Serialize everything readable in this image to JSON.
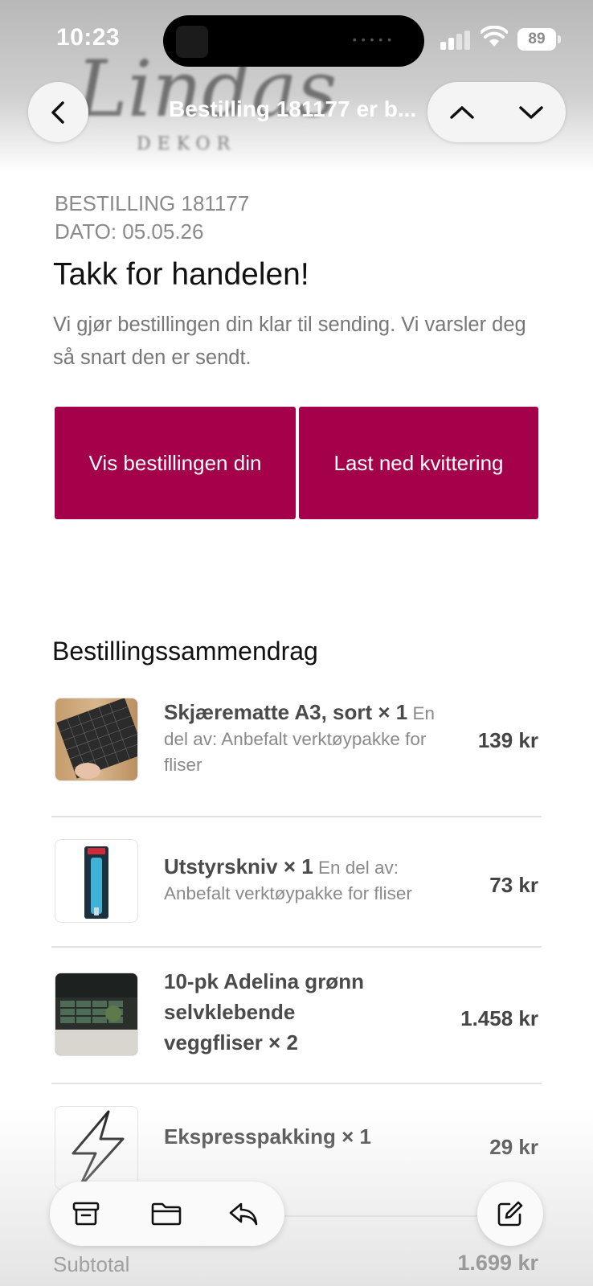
{
  "status_bar": {
    "time": "10:23",
    "battery": "89"
  },
  "header": {
    "logo_script": "Lindas",
    "logo_sub": "DEKOR",
    "title": "Bestilling 181177 er b...",
    "back_icon": "chevron-left-icon",
    "prev_icon": "chevron-up-icon",
    "next_icon": "chevron-down-icon"
  },
  "email": {
    "order_number": "BESTILLING 181177",
    "order_date": "DATO: 05.05.26",
    "headline": "Takk for handelen!",
    "intro": "Vi gjør bestillingen din klar til sending. Vi varsler deg så snart den er sendt.",
    "buttons": {
      "view_order": "Vis bestillingen din",
      "download_receipt": "Last ned kvittering"
    },
    "accent_color": "#a5014a",
    "summary_title": "Bestillingssammendrag",
    "items": [
      {
        "name": "Skjærematte A3, sort × 1",
        "note": "En del av: Anbefalt verktøypakke for fliser",
        "price": "139 kr",
        "image": "cutting-mat-image"
      },
      {
        "name": "Utstyrskniv × 1",
        "note": "En del av: Anbefalt verktøypakke for fliser",
        "price": "73 kr",
        "image": "utility-knife-image"
      },
      {
        "name": "10-pk Adelina grønn selvklebende veggfliser × 2",
        "note": "",
        "price": "1.458 kr",
        "image": "wall-tiles-image"
      },
      {
        "name": "Ekspresspakking × 1",
        "note": "",
        "price": "29 kr",
        "image": "lightning-bolt-icon"
      }
    ],
    "subtotal_label": "Subtotal",
    "subtotal_value": "1.699 kr"
  },
  "toolbar": {
    "archive_icon": "archive-icon",
    "folder_icon": "folder-icon",
    "reply_icon": "reply-icon",
    "compose_icon": "compose-icon"
  }
}
